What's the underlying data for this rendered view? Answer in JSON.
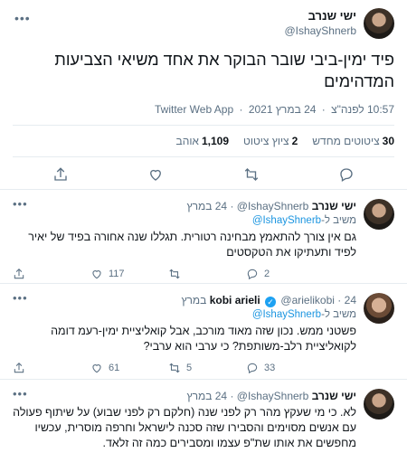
{
  "main_tweet": {
    "display_name": "ישי שנרב",
    "handle": "@IshayShnerb",
    "text": "פיד ימין-ביבי שובר הבוקר את אחד משיאי הצביעות המדהימים",
    "time": "10:57 לפנה\"צ",
    "date": "24 במרץ 2021",
    "source": "Twitter Web App",
    "stats": {
      "quote_count": "30",
      "quote_label": "ציטוטים מחדש",
      "retweet_count": "2",
      "retweet_label": "ציוץ ציטוט",
      "like_count": "1,109",
      "like_label": "אוהב"
    }
  },
  "replies": [
    {
      "display_name": "ישי שנרב",
      "handle": "@IshayShnerb",
      "date": "24 במרץ",
      "replying_label": "משיב ל-",
      "replying_to": "@IshayShnerb",
      "text": "גם אין צורך להתאמץ מבחינה רטורית. תגללו שנה אחורה בפיד של יאיר לפיד ותעתיקו את הטקסטים",
      "reply_count": "2",
      "retweet_count": "",
      "like_count": "117"
    },
    {
      "display_name": "kobi arieli",
      "handle": "@arielikobi",
      "date": "24 במרץ",
      "replying_label": "משיב ל-",
      "replying_to": "@IshayShnerb",
      "text": "פשטני ממש. נכון שזה מאוד מורכב, אבל קואליציית ימין-רעמ דומה לקואליציית רלב-משותפת? כי ערבי הוא ערבי?",
      "reply_count": "33",
      "retweet_count": "5",
      "like_count": "61"
    },
    {
      "display_name": "ישי שנרב",
      "handle": "@IshayShnerb",
      "date": "24 במרץ",
      "text": "לא. כי מי שעקץ מהר רק לפני שנה (חלקם רק לפני שבוע) על שיתוף פעולה עם אנשים מסוימים והסבירו שזה סכנה לישראל וחרפה מוסרית, עכשיו מחפשים את אותו שת\"פ עצמו ומסבירים כמה זה זלאד."
    }
  ]
}
